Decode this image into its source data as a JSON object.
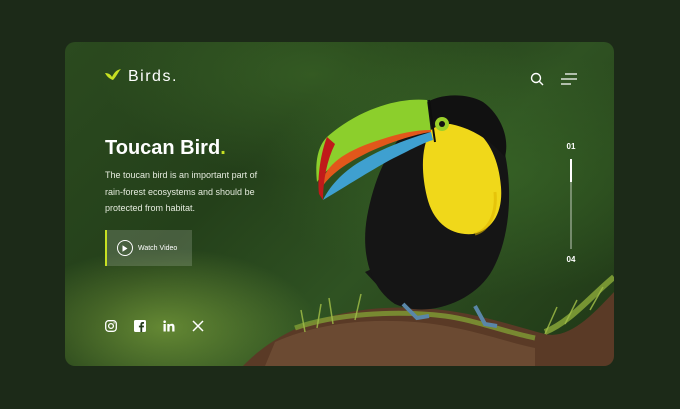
{
  "brand": {
    "name": "Birds."
  },
  "header": {
    "search_icon": "search-icon",
    "menu_icon": "menu-icon"
  },
  "hero": {
    "title": "Toucan Bird",
    "title_dot": ".",
    "description": "The toucan bird is an important part of rain-forest ecosystems and should be protected from habitat.",
    "cta_label": "Watch Video"
  },
  "social": [
    "instagram-icon",
    "facebook-icon",
    "linkedin-icon",
    "x-icon"
  ],
  "pager": {
    "current": "01",
    "total": "04",
    "progress": 0.25
  },
  "colors": {
    "accent": "#c6e022",
    "background": "#1c2a18"
  }
}
